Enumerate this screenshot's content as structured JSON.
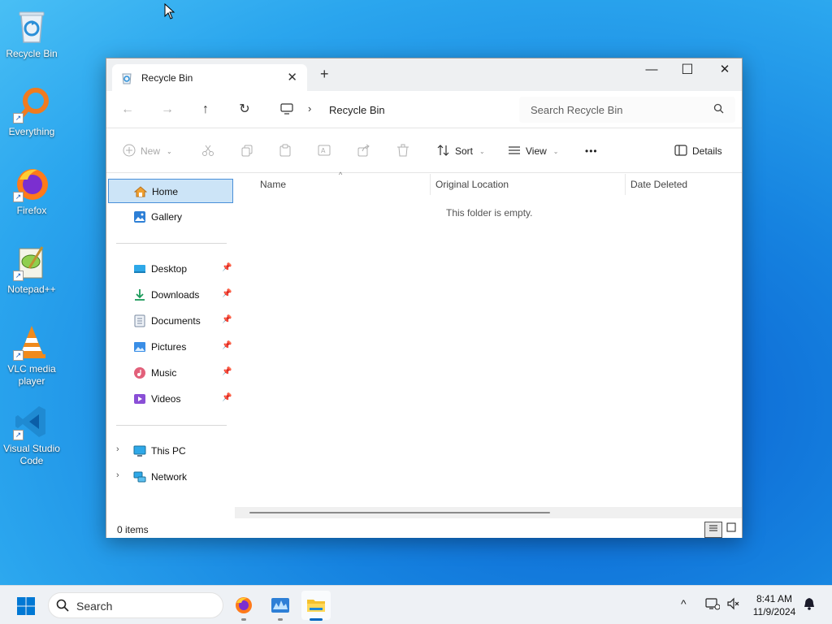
{
  "desktop_icons": [
    {
      "label": "Recycle Bin",
      "icon": "recycle-bin-icon"
    },
    {
      "label": "Everything",
      "icon": "everything-search-icon"
    },
    {
      "label": "Firefox",
      "icon": "firefox-icon"
    },
    {
      "label": "Notepad++",
      "icon": "notepad-plus-plus-icon"
    },
    {
      "label": "VLC media player",
      "icon": "vlc-icon"
    },
    {
      "label": "Visual Studio Code",
      "icon": "vscode-icon"
    }
  ],
  "window": {
    "tab_title": "Recycle Bin",
    "tab_close": "✕",
    "new_tab": "+",
    "controls": {
      "minimize": "—",
      "maximize": "☐",
      "close": "✕"
    }
  },
  "navbar": {
    "back": "←",
    "forward": "→",
    "up": "↑",
    "refresh": "↻",
    "separator": "›",
    "breadcrumb": "Recycle Bin",
    "search_placeholder": "Search Recycle Bin"
  },
  "toolbar": {
    "new_label": "New",
    "sort_label": "Sort",
    "view_label": "View",
    "more_label": "•••",
    "details_label": "Details"
  },
  "sidebar": {
    "items": [
      {
        "label": "Home",
        "icon": "home-icon",
        "selected": true
      },
      {
        "label": "Gallery",
        "icon": "gallery-icon"
      }
    ],
    "quick_access": [
      {
        "label": "Desktop",
        "icon": "desktop-folder-icon"
      },
      {
        "label": "Downloads",
        "icon": "downloads-icon"
      },
      {
        "label": "Documents",
        "icon": "documents-icon"
      },
      {
        "label": "Pictures",
        "icon": "pictures-icon"
      },
      {
        "label": "Music",
        "icon": "music-icon"
      },
      {
        "label": "Videos",
        "icon": "videos-icon"
      }
    ],
    "locations": [
      {
        "label": "This PC",
        "icon": "this-pc-icon"
      },
      {
        "label": "Network",
        "icon": "network-icon"
      }
    ],
    "pin_glyph": "📌",
    "expand_glyph": "›"
  },
  "content": {
    "columns": [
      "Name",
      "Original Location",
      "Date Deleted"
    ],
    "sort_glyph": "^",
    "empty_message": "This folder is empty."
  },
  "statusbar": {
    "item_count": "0 items"
  },
  "taskbar": {
    "search_placeholder": "Search",
    "apps": [
      {
        "name": "Firefox",
        "icon": "firefox-icon",
        "active": false
      },
      {
        "name": "Task Manager",
        "icon": "taskmanager-icon",
        "active": false
      },
      {
        "name": "File Explorer",
        "icon": "file-explorer-icon",
        "active": true
      }
    ],
    "tray_chevron": "^",
    "time": "8:41 AM",
    "date": "11/9/2024"
  },
  "colors": {
    "accent": "#0067c0",
    "selection_bg": "#cce4f7",
    "selection_border": "#4a90d9"
  }
}
